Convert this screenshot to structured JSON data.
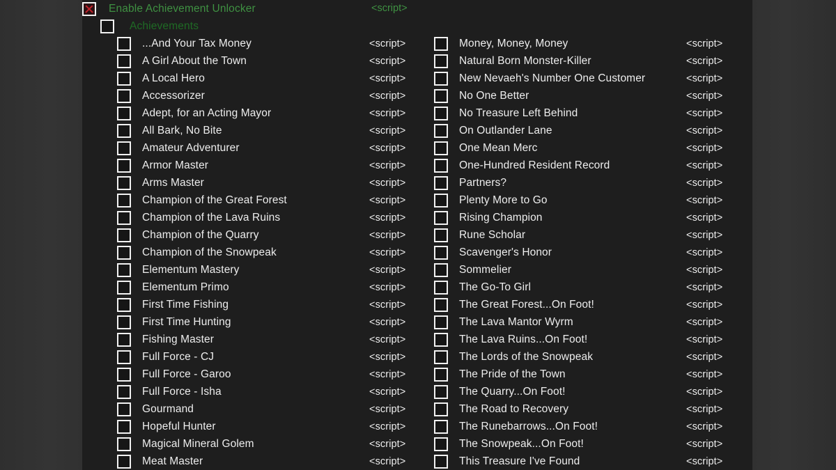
{
  "colors": {
    "accent_green_bright": "#3f9142",
    "accent_green_dim": "#1f6b25",
    "checkbox_check_red": "#c0232b",
    "text": "#ededed",
    "content_background": "#1e1e1e",
    "chrome_background": "#333333"
  },
  "header": {
    "master": {
      "label": "Enable Achievement Unlocker",
      "script_label": "<script>",
      "checked": true
    },
    "group": {
      "label": "Achievements",
      "checked": false
    }
  },
  "script_label": "<script>",
  "columns": {
    "left": [
      "...And Your Tax Money",
      "A Girl About the Town",
      "A Local Hero",
      "Accessorizer",
      "Adept, for an Acting Mayor",
      "All Bark, No Bite",
      "Amateur Adventurer",
      "Armor Master",
      "Arms Master",
      "Champion of the Great Forest",
      "Champion of the Lava Ruins",
      "Champion of the Quarry",
      "Champion of the Snowpeak",
      "Elementum Mastery",
      "Elementum Primo",
      "First Time Fishing",
      "First Time Hunting",
      "Fishing Master",
      "Full Force - CJ",
      "Full Force - Garoo",
      "Full Force - Isha",
      "Gourmand",
      "Hopeful Hunter",
      "Magical Mineral Golem",
      "Meat Master"
    ],
    "right": [
      "Money, Money, Money",
      "Natural Born Monster-Killer",
      "New Nevaeh's Number One Customer",
      "No One Better",
      "No Treasure Left Behind",
      "On Outlander Lane",
      "One Mean Merc",
      "One-Hundred Resident Record",
      "Partners?",
      "Plenty More to Go",
      "Rising Champion",
      "Rune Scholar",
      "Scavenger's Honor",
      "Sommelier",
      "The Go-To Girl",
      "The Great Forest...On Foot!",
      "The Lava Mantor Wyrm",
      "The Lava Ruins...On Foot!",
      "The Lords of the Snowpeak",
      "The Pride of the Town",
      "The Quarry...On Foot!",
      "The Road to Recovery",
      "The Runebarrows...On Foot!",
      "The Snowpeak...On Foot!",
      "This Treasure I've Found"
    ]
  }
}
